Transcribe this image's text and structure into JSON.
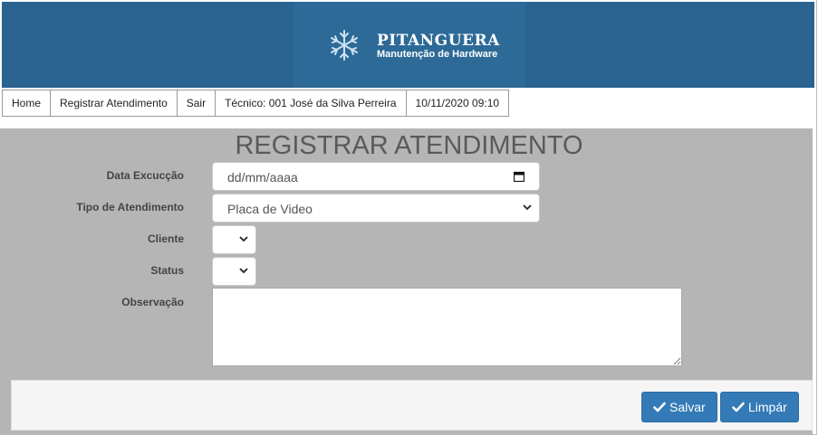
{
  "brand": {
    "name": "PITANGUERA",
    "tagline": "Manutenção de Hardware"
  },
  "nav": {
    "home": "Home",
    "registrar": "Registrar Atendimento",
    "sair": "Sair",
    "tecnico": "Técnico: 001 José da Silva Perreira",
    "datetime": "10/11/2020 09:10"
  },
  "form": {
    "title": "REGISTRAR ATENDIMENTO",
    "data_execucao": {
      "label": "Data Excucção",
      "value": "dd/mm/aaaa"
    },
    "tipo_atendimento": {
      "label": "Tipo de Atendimento",
      "value": "Placa de Video"
    },
    "cliente": {
      "label": "Cliente",
      "value": ""
    },
    "status": {
      "label": "Status",
      "value": ""
    },
    "observacao": {
      "label": "Observação",
      "value": ""
    }
  },
  "actions": {
    "salvar": "Salvar",
    "limpar": "Limpár"
  },
  "colors": {
    "header_bg": "#2a6390",
    "form_bg": "#b5b5b5",
    "primary_button": "#337ab7"
  }
}
